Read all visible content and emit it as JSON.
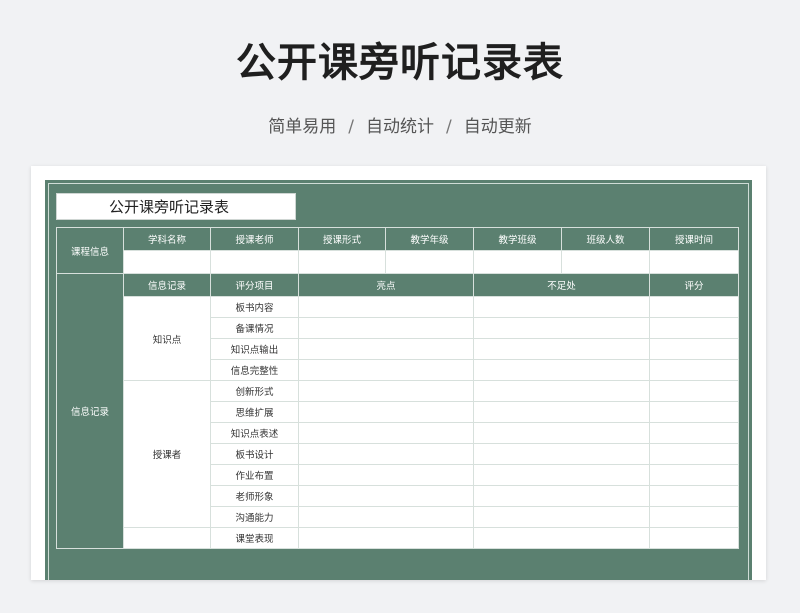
{
  "header": {
    "title": "公开课旁听记录表",
    "features": [
      "简单易用",
      "自动统计",
      "自动更新"
    ],
    "separator": "/"
  },
  "sheet": {
    "title": "公开课旁听记录表",
    "course_info": {
      "row_label": "课程信息",
      "columns": [
        "学科名称",
        "授课老师",
        "授课形式",
        "教学年级",
        "教学班级",
        "班级人数",
        "授课时间"
      ]
    },
    "record": {
      "row_label": "信息记录",
      "headers": {
        "info": "信息记录",
        "item": "评分项目",
        "highlight": "亮点",
        "shortcoming": "不足处",
        "score": "评分"
      },
      "groups": [
        {
          "name": "知识点",
          "items": [
            "板书内容",
            "备课情况",
            "知识点输出",
            "信息完整性"
          ]
        },
        {
          "name": "授课者",
          "items": [
            "创新形式",
            "思维扩展",
            "知识点表述",
            "板书设计",
            "作业布置",
            "老师形象",
            "沟通能力"
          ]
        },
        {
          "name": "",
          "items": [
            "课堂表现"
          ]
        }
      ]
    }
  },
  "colors": {
    "sheet_green": "#5b8070",
    "page_bg": "#f1f2f4"
  }
}
